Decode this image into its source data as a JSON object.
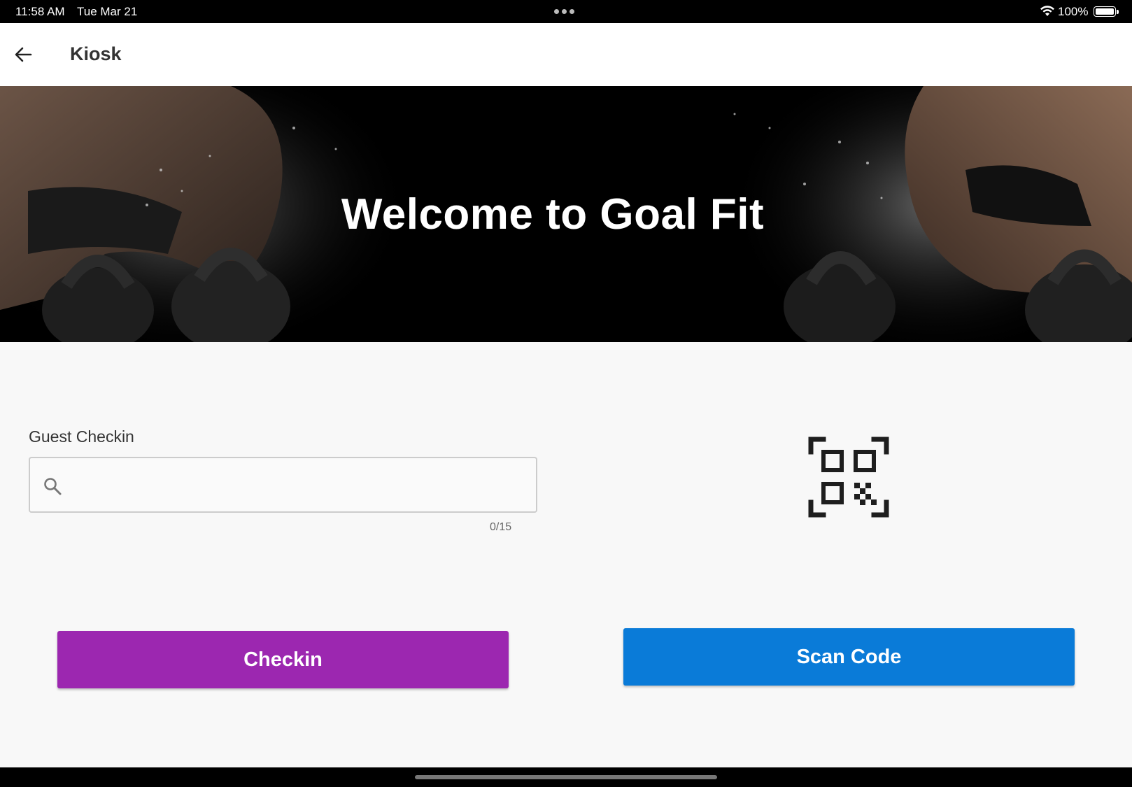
{
  "status_bar": {
    "time": "11:58 AM",
    "date": "Tue Mar 21",
    "battery": "100%"
  },
  "app_bar": {
    "title": "Kiosk"
  },
  "hero": {
    "welcome": "Welcome to Goal Fit"
  },
  "guest_checkin": {
    "label": "Guest Checkin",
    "value": "",
    "counter": "0/15"
  },
  "buttons": {
    "checkin": "Checkin",
    "scan_code": "Scan Code"
  },
  "colors": {
    "checkin_button": "#9c27b0",
    "scan_button": "#0a7bd8"
  }
}
